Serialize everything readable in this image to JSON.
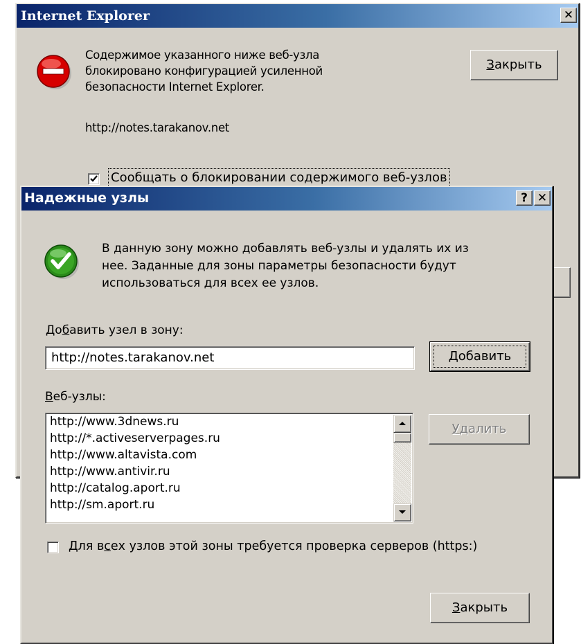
{
  "ie_dialog": {
    "title": "Internet Explorer",
    "close_glyph": "✕",
    "icon": "stop-icon",
    "message_lines": [
      "Содержимое указанного ниже веб-узла",
      "блокировано конфигурацией усиленной",
      "безопасности Internet Explorer."
    ],
    "url": "http://notes.tarakanov.net",
    "close_button": {
      "accel": "З",
      "rest": "акрыть"
    },
    "report_checkbox": {
      "checked": true,
      "label": "Сообщать о блокировании содержимого веб-узлов"
    }
  },
  "trusted_dialog": {
    "title": "Надежные узлы",
    "help_glyph": "?",
    "close_glyph": "✕",
    "icon": "green-check-icon",
    "info_lines": [
      "В данную зону можно добавлять веб-узлы и удалять их из",
      "нее. Заданные для зоны параметры безопасности будут",
      "использоваться для всех ее узлов."
    ],
    "add_label": {
      "pre": "До",
      "accel": "б",
      "rest": "авить узел  в зону:"
    },
    "add_input_value": "http://notes.tarakanov.net",
    "add_button": {
      "accel": "Д",
      "rest": "обавить"
    },
    "sites_label": {
      "accel": "В",
      "rest": "еб-узлы:"
    },
    "sites": [
      "http://www.3dnews.ru",
      "http://*.activeserverpages.ru",
      "http://www.altavista.com",
      "http://www.antivir.ru",
      "http://catalog.aport.ru",
      "http://sm.aport.ru"
    ],
    "remove_button": {
      "accel": "У",
      "rest": "далить",
      "enabled": false
    },
    "https_checkbox": {
      "checked": false,
      "pre": "Для в",
      "accel": "с",
      "rest": "ех узлов этой зоны требуется проверка серверов (https:)"
    },
    "close_button": {
      "accel": "З",
      "rest": "акрыть"
    }
  },
  "colors": {
    "title_gradient_start": "#0a246a",
    "title_gradient_end": "#a6caf0",
    "face": "#d4d0c8",
    "stop_red": "#d60000",
    "check_green": "#2a8a1a"
  }
}
